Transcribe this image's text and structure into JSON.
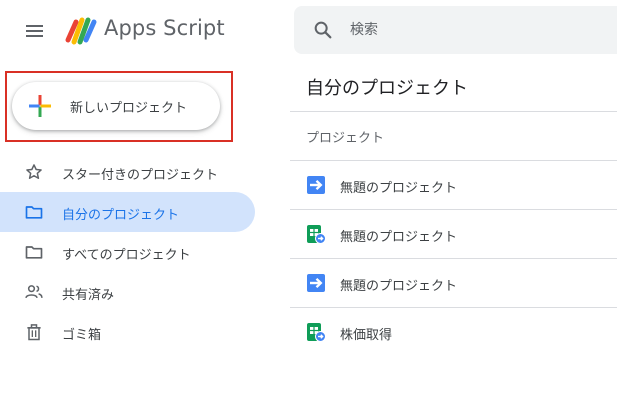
{
  "header": {
    "app_title": "Apps Script",
    "menu_icon": "hamburger-menu-icon",
    "logo_icon": "apps-script-logo-icon"
  },
  "search": {
    "placeholder": "検索",
    "value": "",
    "icon": "search-icon"
  },
  "new_project": {
    "label": "新しいプロジェクト",
    "icon": "colored-plus-icon"
  },
  "sidebar": {
    "items": [
      {
        "label": "スター付きのプロジェクト",
        "icon": "star-icon",
        "active": false
      },
      {
        "label": "自分のプロジェクト",
        "icon": "folder-icon",
        "active": true
      },
      {
        "label": "すべてのプロジェクト",
        "icon": "folder-icon",
        "active": false
      },
      {
        "label": "共有済み",
        "icon": "people-icon",
        "active": false
      },
      {
        "label": "ゴミ箱",
        "icon": "trash-icon",
        "active": false
      }
    ]
  },
  "main": {
    "title": "自分のプロジェクト",
    "column_header": "プロジェクト",
    "projects": [
      {
        "name": "無題のプロジェクト",
        "icon": "apps-script-file-icon"
      },
      {
        "name": "無題のプロジェクト",
        "icon": "sheets-script-icon"
      },
      {
        "name": "無題のプロジェクト",
        "icon": "apps-script-file-icon"
      },
      {
        "name": "株価取得",
        "icon": "sheets-script-icon"
      }
    ]
  },
  "colors": {
    "accent": "#1a73e8",
    "active_bg": "#d2e3fc",
    "highlight_border": "#d93025",
    "script_blue": "#4285f4",
    "sheets_green": "#0f9d58"
  }
}
